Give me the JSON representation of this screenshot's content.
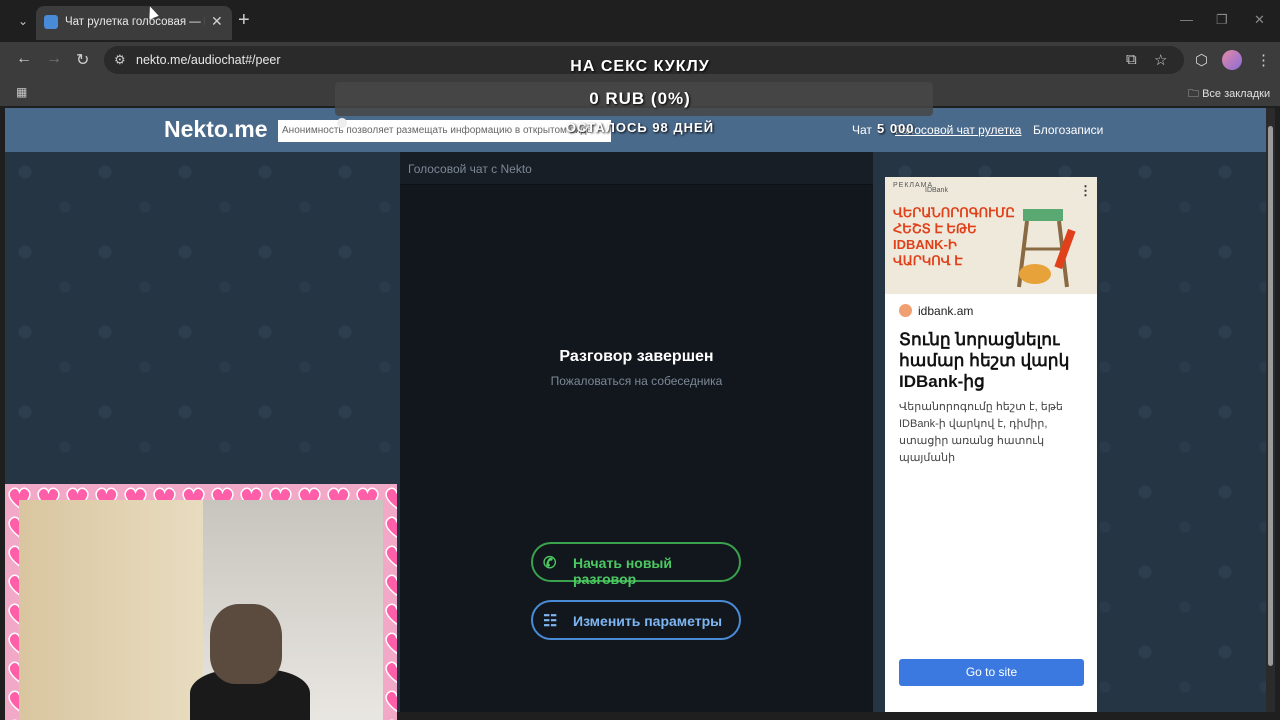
{
  "browser": {
    "tab_title": "Чат рулетка голосовая — Nekto",
    "url": "nekto.me/audiochat#/peer",
    "bookmarks_all": "Все закладки"
  },
  "site": {
    "logo": "Nekto.me",
    "notice": "Анонимность позволяет размещать информацию в открытом виде",
    "nav": {
      "chat": "Чат",
      "roulette": "Голосовой чат рулетка",
      "blog": "Блогозаписи"
    }
  },
  "chat": {
    "header": "Голосовой чат с Nekto",
    "ended": "Разговор завершен",
    "complain": "Пожаловаться на собеседника",
    "new_button": "Начать новый разговор",
    "params_button": "Изменить параметры"
  },
  "ad": {
    "label": "РЕКЛАМА",
    "brand": "IDBank",
    "image_headline": "ՎԵՐԱՆՈՐՈԳՈՒՄԸ ՀԵՇՏ Է ԵԹԵ IDBANK-Ի ՎԱՐԿՈՎ Է",
    "source": "idbank.am",
    "title": "Տունը նորացնելու համար հեշտ վարկ IDBank-ից",
    "body": "Վերանորոգումը հեշտ է, եթե IDBank-ի վարկով է, դիմիր, ստացիր առանց հատուկ պայմանի",
    "cta": "Go to site"
  },
  "stream_overlay": {
    "goal": "НА СЕКС КУКЛУ",
    "amount": "0 RUB (0%)",
    "remaining": "ОСТАЛОСЬ 98 ДНЕЙ",
    "target": "5 000"
  },
  "colors": {
    "site_header": "#4a6a8c",
    "green": "#4cc862",
    "blue": "#7db6f2"
  }
}
